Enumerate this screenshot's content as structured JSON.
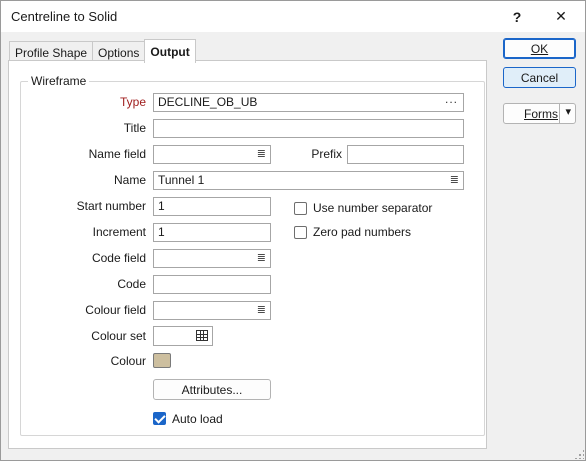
{
  "window": {
    "title": "Centreline to Solid",
    "help_glyph": "?",
    "close_glyph": "✕"
  },
  "tabs": [
    {
      "label": "Profile Shape",
      "active": false
    },
    {
      "label": "Options",
      "active": false
    },
    {
      "label": "Output",
      "active": true
    }
  ],
  "wireframe": {
    "legend": "Wireframe",
    "type_label": "Type",
    "type_value": "DECLINE_OB_UB",
    "title_label": "Title",
    "title_value": "",
    "name_field_label": "Name field",
    "name_field_value": "",
    "prefix_label": "Prefix",
    "prefix_value": "",
    "name_label": "Name",
    "name_value": "Tunnel 1",
    "start_number_label": "Start number",
    "start_number_value": "1",
    "increment_label": "Increment",
    "increment_value": "1",
    "code_field_label": "Code field",
    "code_field_value": "",
    "code_label": "Code",
    "code_value": "",
    "colour_field_label": "Colour field",
    "colour_field_value": "",
    "colour_set_label": "Colour set",
    "colour_set_value": "",
    "colour_label": "Colour",
    "colour_value": "#cdbf9f",
    "attributes_button": "Attributes...",
    "auto_load_label": "Auto load",
    "auto_load_checked": true,
    "use_number_separator_label": "Use number separator",
    "use_number_separator_checked": false,
    "zero_pad_numbers_label": "Zero pad numbers",
    "zero_pad_numbers_checked": false
  },
  "buttons": {
    "ok": "OK",
    "cancel": "Cancel",
    "forms": "Forms",
    "forms_dropdown": "▾"
  },
  "icons": {
    "list": "≣",
    "ellipsis": "...",
    "grid": "grid-icon"
  },
  "colors": {
    "accent": "#1b66c9",
    "required_label": "#a01e1e"
  }
}
